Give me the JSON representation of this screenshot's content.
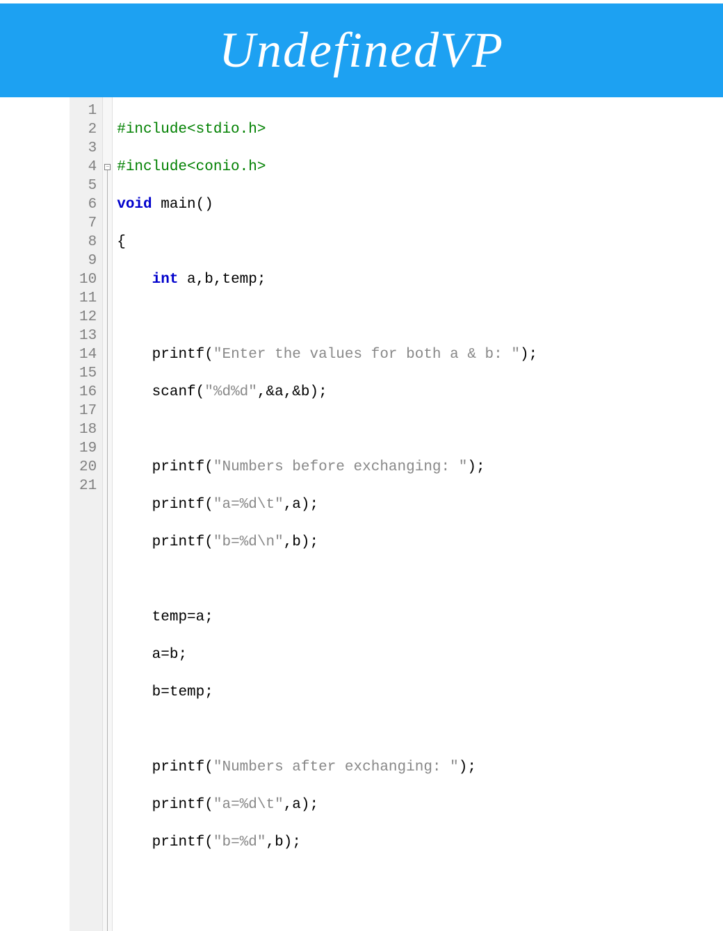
{
  "header": {
    "title": "UndefinedVP"
  },
  "colors": {
    "header_bg": "#1da1f2",
    "header_fg": "#ffffff"
  },
  "fold_marker": "−",
  "lines": {
    "n1": "1",
    "n2": "2",
    "n3": "3",
    "n4": "4",
    "n5": "5",
    "n6": "6",
    "n7": "7",
    "n8": "8",
    "n9": "9",
    "n10": "10",
    "n11": "11",
    "n12": "12",
    "n13": "13",
    "n14": "14",
    "n15": "15",
    "n16": "16",
    "n17": "17",
    "n18": "18",
    "n19": "19",
    "n20": "20",
    "n21": "21"
  },
  "code": {
    "l1": {
      "include": "#include",
      "header": "<stdio.h>"
    },
    "l2": {
      "include": "#include",
      "header": "<conio.h>"
    },
    "l3": {
      "kw_void": "void",
      "sp": " ",
      "fn": "main",
      "parens": "()"
    },
    "l4": {
      "brace": "{"
    },
    "l5": {
      "indent": "    ",
      "kw_int": "int",
      "rest": " a,b,temp;"
    },
    "l6": {
      "blank": ""
    },
    "l7": {
      "indent": "    ",
      "fn": "printf",
      "open": "(",
      "str": "\"Enter the values for both a & b: \"",
      "close": ");"
    },
    "l8": {
      "indent": "    ",
      "fn": "scanf",
      "open": "(",
      "str": "\"%d%d\"",
      "args": ",&a,&b",
      "close": ");"
    },
    "l9": {
      "blank": ""
    },
    "l10": {
      "indent": "    ",
      "fn": "printf",
      "open": "(",
      "str": "\"Numbers before exchanging: \"",
      "close": ");"
    },
    "l11": {
      "indent": "    ",
      "fn": "printf",
      "open": "(",
      "str": "\"a=%d\\t\"",
      "args": ",a",
      "close": ");"
    },
    "l12": {
      "indent": "    ",
      "fn": "printf",
      "open": "(",
      "str": "\"b=%d\\n\"",
      "args": ",b",
      "close": ");"
    },
    "l13": {
      "blank": ""
    },
    "l14": {
      "indent": "    ",
      "stmt": "temp=a;"
    },
    "l15": {
      "indent": "    ",
      "stmt": "a=b;"
    },
    "l16": {
      "indent": "    ",
      "stmt": "b=temp;"
    },
    "l17": {
      "blank": ""
    },
    "l18": {
      "indent": "    ",
      "fn": "printf",
      "open": "(",
      "str": "\"Numbers after exchanging: \"",
      "close": ");"
    },
    "l19": {
      "indent": "    ",
      "fn": "printf",
      "open": "(",
      "str": "\"a=%d\\t\"",
      "args": ",a",
      "close": ");"
    },
    "l20": {
      "indent": "    ",
      "fn": "printf",
      "open": "(",
      "str": "\"b=%d\"",
      "args": ",b",
      "close": ");"
    },
    "l21": {
      "blank": ""
    }
  }
}
